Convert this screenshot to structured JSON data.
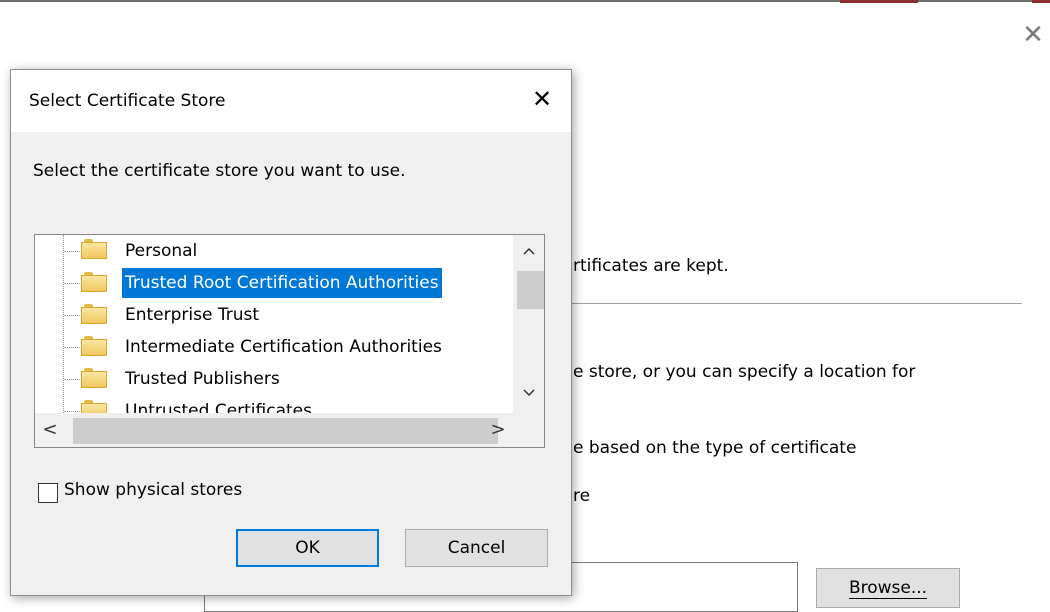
{
  "background_wizard": {
    "close_glyph": "✕",
    "line1": "rtificates are kept.",
    "line2": "e store, or you can specify a location for",
    "line3": "e based on the type of certificate",
    "line4": "re",
    "browse_label": "Browse..."
  },
  "dialog": {
    "title": "Select Certificate Store",
    "close_glyph": "✕",
    "instruction": "Select the certificate store you want to use.",
    "tree_items": [
      {
        "label": "Personal",
        "selected": false
      },
      {
        "label": "Trusted Root Certification Authorities",
        "selected": true
      },
      {
        "label": "Enterprise Trust",
        "selected": false
      },
      {
        "label": "Intermediate Certification Authorities",
        "selected": false
      },
      {
        "label": "Trusted Publishers",
        "selected": false
      },
      {
        "label": "Untrusted Certificates",
        "selected": false
      }
    ],
    "scroll_glyphs": {
      "up": "▲",
      "down": "▼",
      "left": "<",
      "right": ">"
    },
    "show_physical_label": "Show physical stores",
    "show_physical_checked": false,
    "ok_label": "OK",
    "cancel_label": "Cancel"
  },
  "colors": {
    "selection": "#0078d7",
    "folder": "#f1c75c",
    "dialog_bg": "#f0f0f0"
  },
  "icons": {
    "tree_item_icon": "folder-icon",
    "close": "close-icon"
  }
}
